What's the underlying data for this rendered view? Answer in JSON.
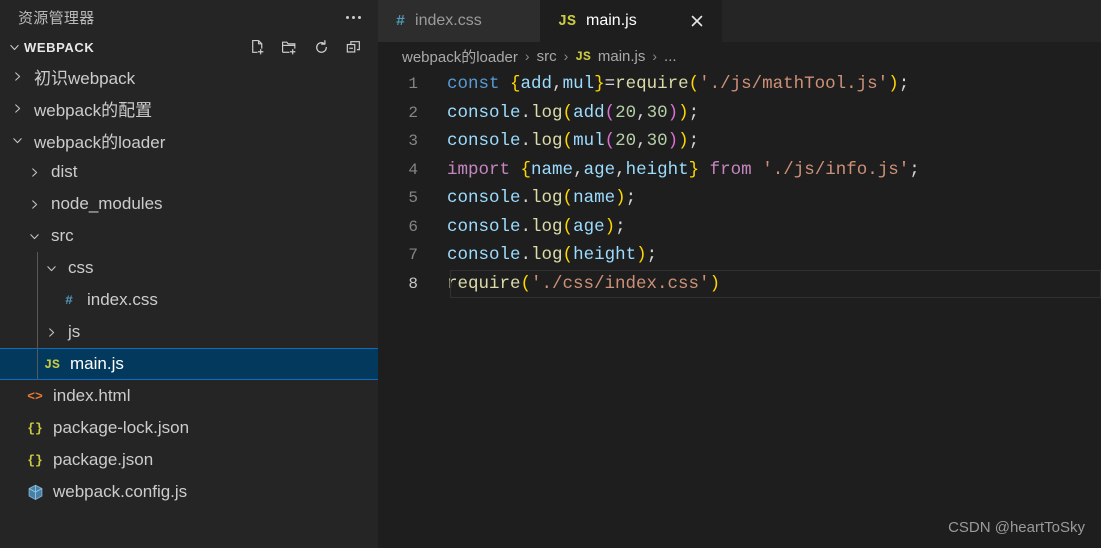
{
  "sidebar": {
    "title": "资源管理器",
    "more_actions_label": "...",
    "section": {
      "name": "WEBPACK",
      "expanded": true,
      "actions": [
        {
          "name": "new-file-icon",
          "label": "新建文件"
        },
        {
          "name": "new-folder-icon",
          "label": "新建文件夹"
        },
        {
          "name": "refresh-icon",
          "label": "刷新资源管理器"
        },
        {
          "name": "collapse-all-icon",
          "label": "在资源管理器中折叠文件夹"
        }
      ]
    },
    "tree": [
      {
        "label": "初识webpack",
        "type": "folder",
        "expanded": false,
        "depth": 0,
        "icon": "chevron-right-icon",
        "selected": false
      },
      {
        "label": "webpack的配置",
        "type": "folder",
        "expanded": false,
        "depth": 0,
        "icon": "chevron-right-icon",
        "selected": false
      },
      {
        "label": "webpack的loader",
        "type": "folder",
        "expanded": true,
        "depth": 0,
        "icon": "chevron-down-icon",
        "selected": false
      },
      {
        "label": "dist",
        "type": "folder",
        "expanded": false,
        "depth": 1,
        "icon": "chevron-right-icon",
        "selected": false
      },
      {
        "label": "node_modules",
        "type": "folder",
        "expanded": false,
        "depth": 1,
        "icon": "chevron-right-icon",
        "selected": false
      },
      {
        "label": "src",
        "type": "folder",
        "expanded": true,
        "depth": 1,
        "icon": "chevron-down-icon",
        "selected": false
      },
      {
        "label": "css",
        "type": "folder",
        "expanded": true,
        "depth": 2,
        "icon": "chevron-down-icon",
        "selected": false
      },
      {
        "label": "index.css",
        "type": "file",
        "depth": 3,
        "icon": "css-file-icon",
        "glyph": "#",
        "color": "#519aba",
        "selected": false
      },
      {
        "label": "js",
        "type": "folder",
        "expanded": false,
        "depth": 2,
        "icon": "chevron-right-icon",
        "selected": false
      },
      {
        "label": "main.js",
        "type": "file",
        "depth": 2,
        "icon": "js-file-icon",
        "glyph": "JS",
        "color": "#cbcb41",
        "selected": true
      },
      {
        "label": "index.html",
        "type": "file",
        "depth": 1,
        "icon": "html-file-icon",
        "glyph": "<>",
        "color": "#e37933",
        "selected": false
      },
      {
        "label": "package-lock.json",
        "type": "file",
        "depth": 1,
        "icon": "json-file-icon",
        "glyph": "{}",
        "color": "#cbcb41",
        "selected": false
      },
      {
        "label": "package.json",
        "type": "file",
        "depth": 1,
        "icon": "json-file-icon",
        "glyph": "{}",
        "color": "#cbcb41",
        "selected": false
      },
      {
        "label": "webpack.config.js",
        "type": "file",
        "depth": 1,
        "icon": "webpack-cube-icon",
        "glyph": "",
        "color": "#519aba",
        "selected": false
      }
    ]
  },
  "editor": {
    "tabs": [
      {
        "label": "index.css",
        "glyph": "#",
        "color": "#519aba",
        "active": false,
        "closable": false
      },
      {
        "label": "main.js",
        "glyph": "JS",
        "color": "#cbcb41",
        "active": true,
        "closable": true,
        "close_label": "×"
      }
    ],
    "breadcrumb": [
      {
        "label": "webpack的loader",
        "glyph": ""
      },
      {
        "label": "src",
        "glyph": ""
      },
      {
        "label": "main.js",
        "glyph": "JS"
      },
      {
        "label": "...",
        "glyph": ""
      }
    ],
    "breadcrumb_separator": "›",
    "current_line": 8,
    "lines": [
      {
        "n": "1",
        "text": "const {add,mul}=require('./js/mathTool.js');"
      },
      {
        "n": "2",
        "text": "console.log(add(20,30));"
      },
      {
        "n": "3",
        "text": "console.log(mul(20,30));"
      },
      {
        "n": "4",
        "text": "import {name,age,height} from './js/info.js';"
      },
      {
        "n": "5",
        "text": "console.log(name);"
      },
      {
        "n": "6",
        "text": "console.log(age);"
      },
      {
        "n": "7",
        "text": "console.log(height);"
      },
      {
        "n": "8",
        "text": "require('./css/index.css')"
      }
    ]
  },
  "watermark": "CSDN @heartToSky",
  "colors": {
    "sidebar_bg": "#252526",
    "editor_bg": "#1e1e1e",
    "tab_inactive_bg": "#2d2d2d",
    "selection_bg": "#04395e",
    "selection_border": "#0a6cbe",
    "accent_js": "#cbcb41",
    "accent_css": "#519aba",
    "accent_html": "#e37933"
  }
}
